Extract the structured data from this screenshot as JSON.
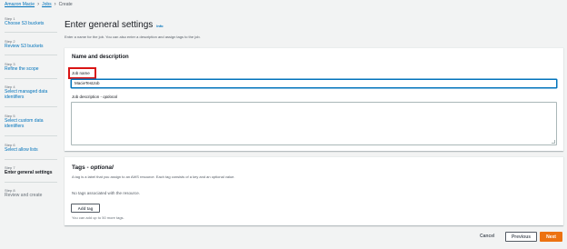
{
  "breadcrumb": {
    "items": [
      "Amazon Macie",
      "Jobs",
      "Create"
    ]
  },
  "steps": [
    {
      "num": "Step 1",
      "label": "Choose S3 buckets",
      "state": "link"
    },
    {
      "num": "Step 2",
      "label": "Review S3 buckets",
      "state": "link"
    },
    {
      "num": "Step 3",
      "label": "Refine the scope",
      "state": "link"
    },
    {
      "num": "Step 4",
      "label": "Select managed data identifiers",
      "state": "link"
    },
    {
      "num": "Step 5",
      "label": "Select custom data identifiers",
      "state": "link"
    },
    {
      "num": "Step 6",
      "label": "Select allow lists",
      "state": "link"
    },
    {
      "num": "Step 7",
      "label": "Enter general settings",
      "state": "active"
    },
    {
      "num": "Step 8",
      "label": "Review and create",
      "state": "disabled"
    }
  ],
  "page": {
    "title": "Enter general settings",
    "info": "Info",
    "subtitle": "Enter a name for the job. You can also enter a description and assign tags to the job."
  },
  "name_section": {
    "header": "Name and description",
    "job_name_label": "Job name",
    "job_name_value": "MacieTestJob",
    "desc_label": "Job description -",
    "desc_optional": "optional",
    "desc_value": ""
  },
  "tags_section": {
    "title": "Tags -",
    "title_optional": "optional",
    "description": "A tag is a label that you assign to an AWS resource. Each tag consists of a key and an optional value.",
    "empty_text": "No tags associated with the resource.",
    "add_label": "Add tag",
    "hint": "You can add up to 50 more tags."
  },
  "footer": {
    "cancel": "Cancel",
    "previous": "Previous",
    "next": "Next"
  },
  "colors": {
    "accent": "#0073bb",
    "primary_button": "#ec7211",
    "highlight_box": "#d91515"
  }
}
